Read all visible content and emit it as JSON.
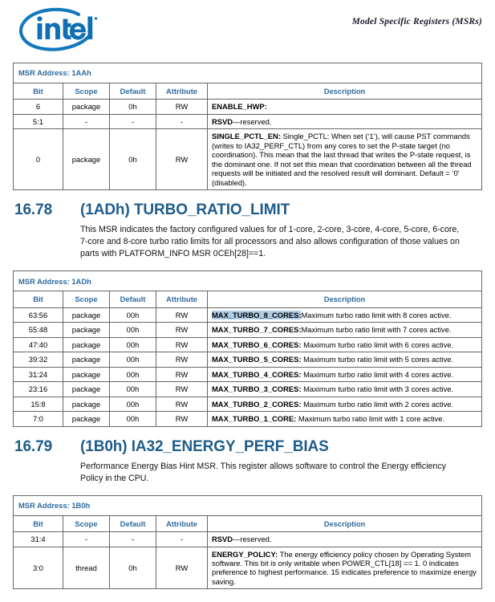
{
  "header": {
    "logo_alt": "intel",
    "title": "Model Specific Registers (MSRs)"
  },
  "table_columns": [
    "Bit",
    "Scope",
    "Default",
    "Attribute",
    "Description"
  ],
  "tables": [
    {
      "address_label": "MSR Address: 1AAh",
      "rows": [
        {
          "bit": "6",
          "scope": "package",
          "default": "0h",
          "attribute": "RW",
          "desc_bold": "ENABLE_HWP:",
          "desc_rest": "",
          "highlight": false
        },
        {
          "bit": "5:1",
          "scope": "-",
          "default": "-",
          "attribute": "-",
          "desc_bold": "RSVD",
          "desc_rest": "—reserved.",
          "highlight": false
        },
        {
          "bit": "0",
          "scope": "package",
          "default": "0h",
          "attribute": "RW",
          "desc_bold": "SINGLE_PCTL_EN:",
          "desc_rest": " Single_PCTL: When set (‘1’), will cause PST commands (writes to IA32_PERF_CTL) from any cores to set the P-state target (no coordination). This mean that the last thread that writes the P-state request, is the dominant one. If not set this mean that coordination between all the thread requests will be initiated and the resolved result will dominant. Default = ‘0’ (disabled).",
          "highlight": false
        }
      ]
    },
    {
      "address_label": "MSR Address: 1ADh",
      "rows": [
        {
          "bit": "63:56",
          "scope": "package",
          "default": "00h",
          "attribute": "RW",
          "desc_bold": "MAX_TURBO_8_CORES:",
          "desc_rest": "Maximum turbo ratio limit with 8 cores active.",
          "highlight": true
        },
        {
          "bit": "55:48",
          "scope": "package",
          "default": "00h",
          "attribute": "RW",
          "desc_bold": "MAX_TURBO_7_CORES:",
          "desc_rest": "Maximum turbo ratio limit with 7 cores active.",
          "highlight": false
        },
        {
          "bit": "47:40",
          "scope": "package",
          "default": "00h",
          "attribute": "RW",
          "desc_bold": "MAX_TURBO_6_CORES:",
          "desc_rest": " Maximum turbo ratio limit with 6 cores active.",
          "highlight": false
        },
        {
          "bit": "39:32",
          "scope": "package",
          "default": "00h",
          "attribute": "RW",
          "desc_bold": "MAX_TURBO_5_CORES:",
          "desc_rest": " Maximum turbo ratio limit with 5 cores active.",
          "highlight": false
        },
        {
          "bit": "31:24",
          "scope": "package",
          "default": "00h",
          "attribute": "RW",
          "desc_bold": "MAX_TURBO_4_CORES:",
          "desc_rest": " Maximum turbo ratio limit with 4 cores active.",
          "highlight": false
        },
        {
          "bit": "23:16",
          "scope": "package",
          "default": "00h",
          "attribute": "RW",
          "desc_bold": "MAX_TURBO_3_CORES:",
          "desc_rest": " Maximum turbo ratio limit with 3 cores active.",
          "highlight": false
        },
        {
          "bit": "15:8",
          "scope": "package",
          "default": "00h",
          "attribute": "RW",
          "desc_bold": "MAX_TURBO_2_CORES:",
          "desc_rest": " Maximum turbo ratio limit with 2 cores active.",
          "highlight": false
        },
        {
          "bit": "7:0",
          "scope": "package",
          "default": "00h",
          "attribute": "RW",
          "desc_bold": "MAX_TURBO_1_CORE:",
          "desc_rest": " Maximum turbo ratio limit with 1 core active.",
          "highlight": false
        }
      ]
    },
    {
      "address_label": "MSR Address: 1B0h",
      "rows": [
        {
          "bit": "31:4",
          "scope": "-",
          "default": "-",
          "attribute": "-",
          "desc_bold": "RSVD",
          "desc_rest": "—reserved.",
          "highlight": false
        },
        {
          "bit": "3:0",
          "scope": "thread",
          "default": "0h",
          "attribute": "RW",
          "desc_bold": "ENERGY_POLICY:",
          "desc_rest": " The energy efficiency policy chosen by Operating System software. This bit is only writable when POWER_CTL[18] == 1. 0 indicates preference to highest performance. 15 indicates preference to maximize energy saving.",
          "highlight": false
        }
      ]
    }
  ],
  "sections": [
    {
      "number": "16.78",
      "title": "(1ADh) TURBO_RATIO_LIMIT",
      "body": "This MSR indicates the factory configured values for of 1-core, 2-core, 3-core, 4-core, 5-core, 6-core, 7-core and 8-core turbo ratio limits for all processors and also allows configuration of those values on parts with PLATFORM_INFO MSR 0CEh[28]==1."
    },
    {
      "number": "16.79",
      "title": "(1B0h) IA32_ENERGY_PERF_BIAS",
      "body": "Performance Energy Bias Hint MSR. This register allows software to control the Energy efficiency Policy in the CPU."
    }
  ],
  "colors": {
    "intel_blue": "#0b74ba",
    "heading_blue": "#1f5c8b",
    "table_header_blue": "#2f6b9e",
    "selection_highlight": "#aecce6"
  }
}
